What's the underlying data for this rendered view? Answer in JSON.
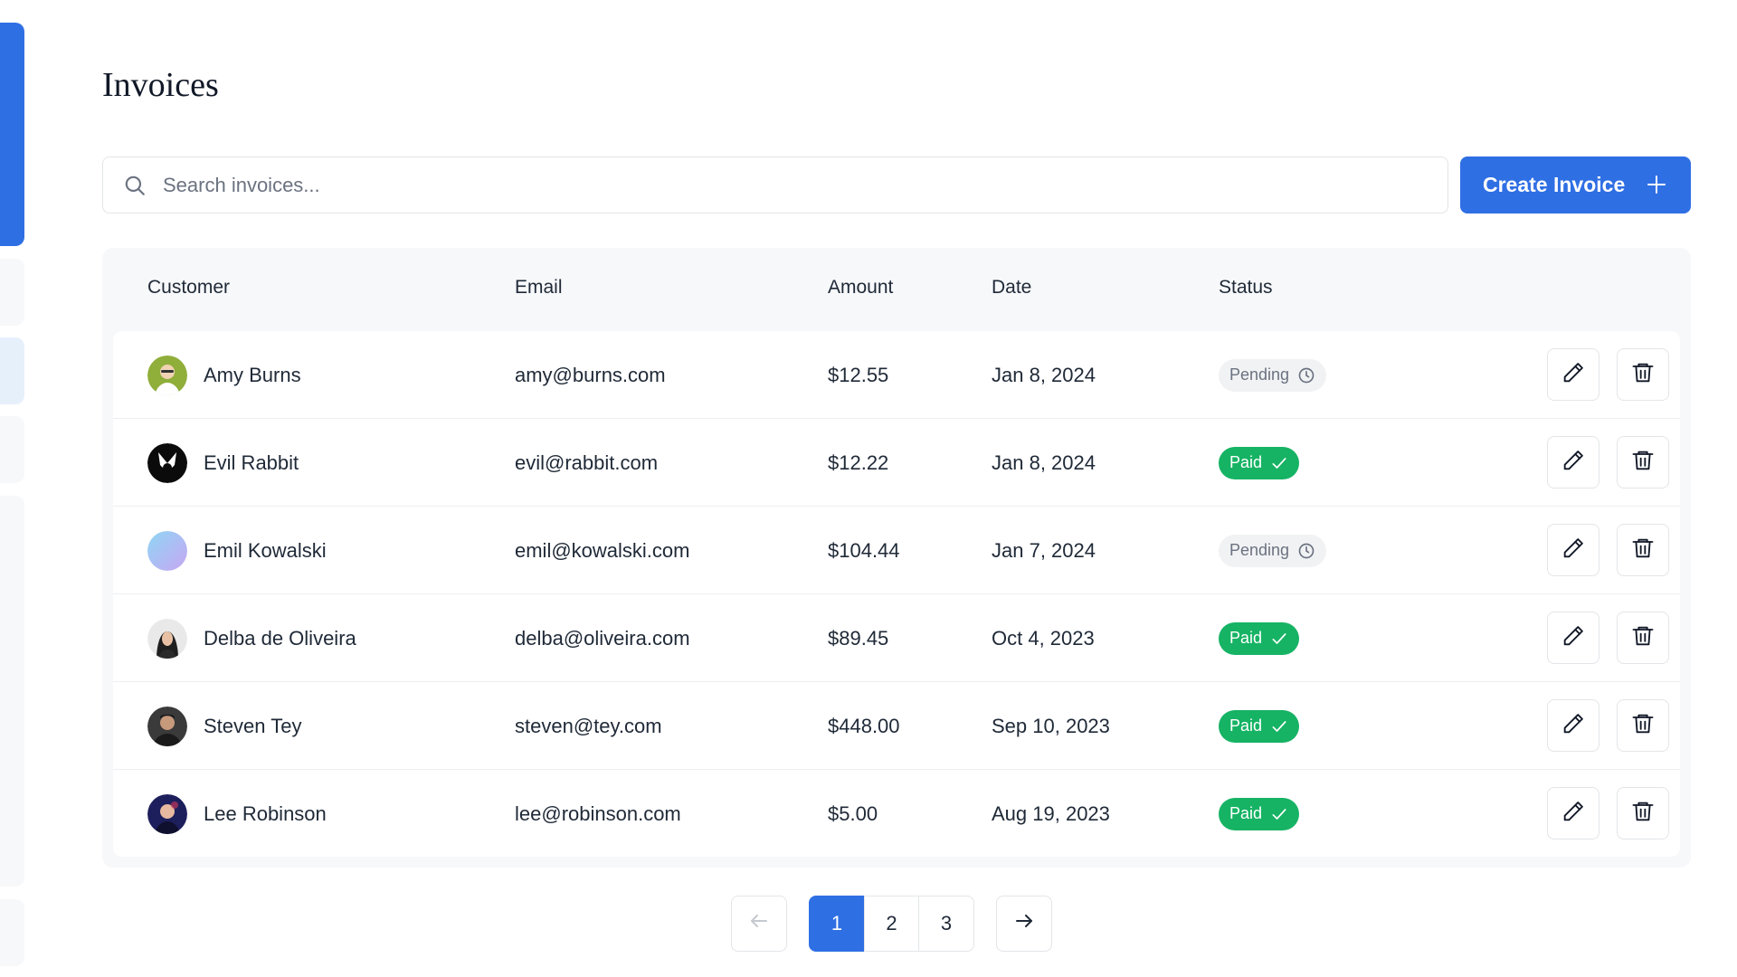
{
  "page": {
    "title": "Invoices"
  },
  "search": {
    "placeholder": "Search invoices...",
    "value": ""
  },
  "toolbar": {
    "create_label": "Create Invoice"
  },
  "table": {
    "columns": {
      "customer": "Customer",
      "email": "Email",
      "amount": "Amount",
      "date": "Date",
      "status": "Status"
    },
    "rows": [
      {
        "name": "Amy Burns",
        "email": "amy@burns.com",
        "amount": "$12.55",
        "date": "Jan 8, 2024",
        "status": "Pending"
      },
      {
        "name": "Evil Rabbit",
        "email": "evil@rabbit.com",
        "amount": "$12.22",
        "date": "Jan 8, 2024",
        "status": "Paid"
      },
      {
        "name": "Emil Kowalski",
        "email": "emil@kowalski.com",
        "amount": "$104.44",
        "date": "Jan 7, 2024",
        "status": "Pending"
      },
      {
        "name": "Delba de Oliveira",
        "email": "delba@oliveira.com",
        "amount": "$89.45",
        "date": "Oct 4, 2023",
        "status": "Paid"
      },
      {
        "name": "Steven Tey",
        "email": "steven@tey.com",
        "amount": "$448.00",
        "date": "Sep 10, 2023",
        "status": "Paid"
      },
      {
        "name": "Lee Robinson",
        "email": "lee@robinson.com",
        "amount": "$5.00",
        "date": "Aug 19, 2023",
        "status": "Paid"
      }
    ]
  },
  "pagination": {
    "pages": [
      "1",
      "2",
      "3"
    ],
    "current": "1"
  },
  "colors": {
    "accent": "#2f6fe4",
    "paid": "#16b364",
    "pending_bg": "#f1f2f4",
    "panel_bg": "#f7f8fa"
  },
  "icons": {
    "search": "search-icon",
    "create": "plus-icon",
    "pending": "clock-icon",
    "paid": "check-icon",
    "edit": "pencil-icon",
    "delete": "trash-icon",
    "prev": "arrow-left-icon",
    "next": "arrow-right-icon"
  }
}
